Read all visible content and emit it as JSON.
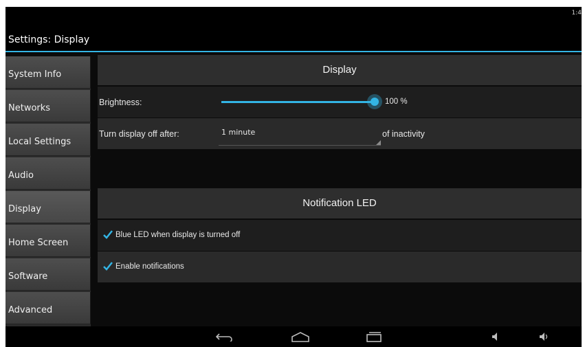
{
  "status_bar": {
    "time": "1:4"
  },
  "app": {
    "title": "Settings: Display"
  },
  "sidebar": {
    "items": [
      {
        "label": "System Info"
      },
      {
        "label": "Networks"
      },
      {
        "label": "Local Settings"
      },
      {
        "label": "Audio"
      },
      {
        "label": "Display",
        "selected": true
      },
      {
        "label": "Home Screen"
      },
      {
        "label": "Software"
      },
      {
        "label": "Advanced"
      }
    ]
  },
  "display_section": {
    "header": "Display",
    "brightness": {
      "label": "Brightness:",
      "value_text": "100 %",
      "value": 100
    },
    "display_off": {
      "label": "Turn display off after:",
      "selected": "1 minute",
      "suffix": "of inactivity"
    }
  },
  "notification_section": {
    "header": "Notification LED",
    "options": [
      {
        "label": "Blue LED when display is turned off",
        "checked": true
      },
      {
        "label": "Enable notifications",
        "checked": true
      }
    ]
  },
  "nav_bar": {
    "icons": [
      "back-icon",
      "home-icon",
      "recent-apps-icon",
      "volume-down-icon",
      "volume-up-icon"
    ]
  },
  "colors": {
    "accent": "#33b5e5",
    "background": "#0b0b0b",
    "panel": "#2e2e2e"
  }
}
